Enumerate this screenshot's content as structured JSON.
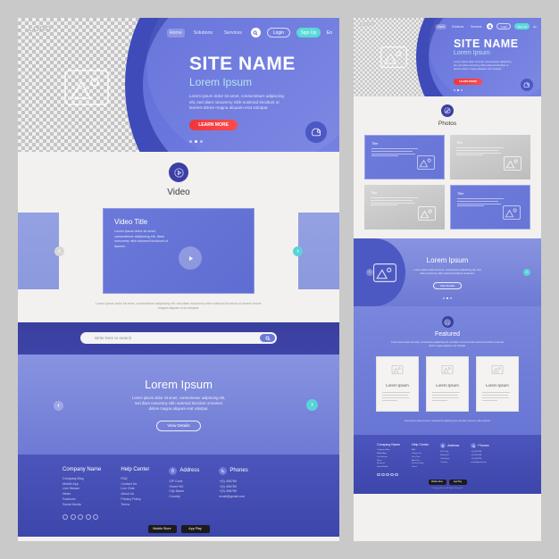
{
  "brand": {
    "logo_text": "LOGO",
    "accent_blue": "#5d6ad6",
    "accent_dark_blue": "#3f4bb8",
    "accent_teal": "#5ad9d9",
    "accent_red": "#f0353a",
    "page_bg": "#f2f1ef",
    "canvas_bg": "#c9c9c9"
  },
  "nav": {
    "links": [
      {
        "label": "Home",
        "active": true
      },
      {
        "label": "Solutions",
        "active": false
      },
      {
        "label": "Services",
        "active": false
      }
    ],
    "search_icon": "search-icon",
    "login_label": "Login",
    "signup_label": "Sign Up",
    "language_label": "En"
  },
  "hero": {
    "title": "SITE NAME",
    "subtitle": "Lorem Ipsum",
    "body": "Lorem ipsum dolor sit amet, consectetuer adipiscing elit, sed diam nonummy nibh euismod tincidunt ut laoreet dolore magna aliquam erat volutpat.",
    "cta_label": "LEARN MORE",
    "dots": 3,
    "active_dot": 2,
    "chat_icon": "chat-bubble-icon",
    "image_placeholder_icon": "image-placeholder-icon"
  },
  "video_section": {
    "icon": "play-circle-icon",
    "title": "Video",
    "card_title": "Video Title",
    "card_body": "Lorem ipsum dolor sit amet, consectetuer adipiscing elit, diam nonummy nibh euismod tincidunt ut laoreet.",
    "play_icon": "play-icon",
    "prev_label": "‹",
    "next_label": "›",
    "caption": "Lorem ipsum dolor sit amet, consectetuer adipiscing elit, sed diam nonummy nibh euismod tincidunt ut laoreet dolore magna aliquam erat volutpat."
  },
  "search_band": {
    "placeholder": "Write here to search",
    "value": "",
    "submit_icon": "search-icon"
  },
  "promo": {
    "title": "Lorem Ipsum",
    "body": "Lorem ipsum dolor sit amet, consectetuer adipiscing elit, sed diam nonummy nibh euismod tincidunt ut laoreet dolore magna aliquam erat volutpat.",
    "cta_label": "View Details",
    "prev_label": "‹",
    "next_label": "›"
  },
  "photos": {
    "icon": "photos-icon",
    "title": "Photos",
    "cards": [
      {
        "title": "Title",
        "style": "blue"
      },
      {
        "title": "Title",
        "style": "grey"
      },
      {
        "title": "Title",
        "style": "grey"
      },
      {
        "title": "Title",
        "style": "blue"
      }
    ]
  },
  "promo_right": {
    "title": "Lorem Ipsum",
    "body": "Lorem ipsum dolor sit amet, consectetuer adipiscing elit, sed diam nonummy nibh euismod tincidunt ut laoreet.",
    "cta_label": "View Details",
    "image_icon": "image-placeholder-icon",
    "prev_label": "‹",
    "next_label": "›"
  },
  "featured": {
    "icon": "star-icon",
    "title": "Featured",
    "subtitle": "Lorem ipsum dolor sit amet, consectetuer adipiscing elit, sed diam nonummy nibh euismod tincidunt ut laoreet dolore magna aliquam erat volutpat.",
    "cards": [
      {
        "title": "Lorem Ipsum",
        "icon": "image-placeholder-icon"
      },
      {
        "title": "Lorem Ipsum",
        "icon": "image-placeholder-icon"
      },
      {
        "title": "Lorem Ipsum",
        "icon": "image-placeholder-icon"
      }
    ],
    "note": "Lorem ipsum dolor sit amet, consectetuer adipiscing elit, sed diam nonummy nibh euismod."
  },
  "footer": {
    "columns": [
      {
        "heading": "Company Name",
        "icon": null,
        "links": [
          "Company Blog",
          "Mobile App",
          "Live Stream",
          "News",
          "Featured",
          "Social Media"
        ]
      },
      {
        "heading": "Help Center",
        "icon": null,
        "links": [
          "FAQ",
          "Contact Us",
          "Live Chat",
          "About Us",
          "Privacy Policy",
          "Terms"
        ]
      },
      {
        "heading": "Address",
        "icon": "location-pin-icon",
        "links": [
          "ZIP Code",
          "Street NO",
          "City Name",
          "Country"
        ]
      },
      {
        "heading": "Phones",
        "icon": "phone-icon",
        "links": [
          "+(0) 456789",
          "+(0) 456789",
          "+(0) 456789",
          "email@gmail.com"
        ]
      }
    ],
    "socials": [
      "facebook-icon",
      "twitter-icon",
      "instagram-icon",
      "youtube-icon",
      "linkedin-icon"
    ],
    "store_buttons": [
      "Mobile Store",
      "App Play"
    ],
    "copyright": "Company Name. All Rights Reserved."
  }
}
